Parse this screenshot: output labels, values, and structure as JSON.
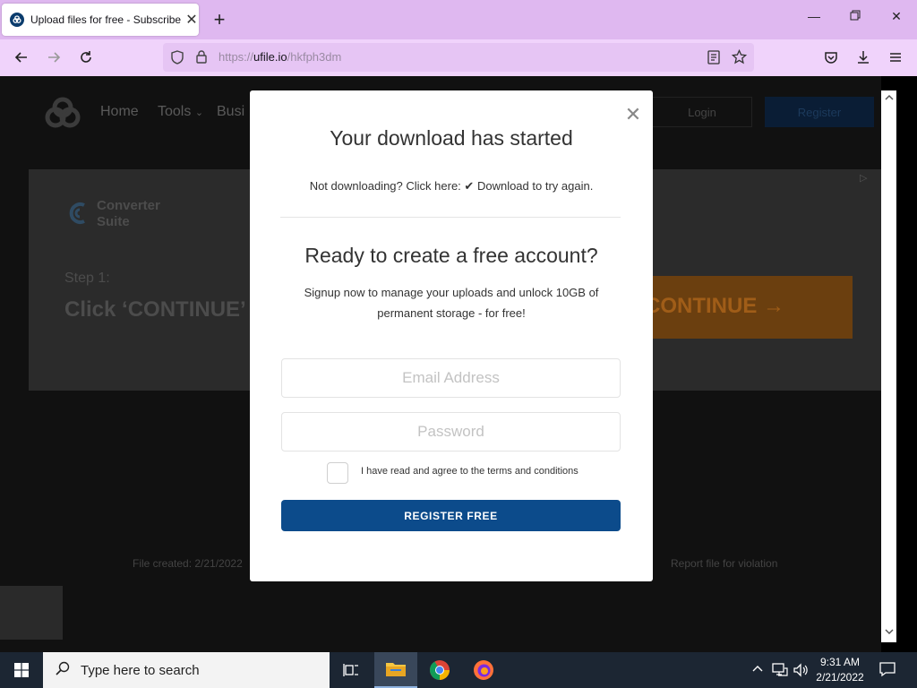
{
  "browser": {
    "tab_title": "Upload files for free - Subscribe",
    "url_prefix": "https://",
    "url_host": "ufile.io",
    "url_path": "/hkfph3dm"
  },
  "site": {
    "nav": [
      "Home",
      "Tools",
      "Busi"
    ],
    "login": "Login",
    "register": "Register",
    "file_created": "File created: 2/21/2022",
    "report": "Report file for violation"
  },
  "ad": {
    "brand": "Converter Suite",
    "step": "Step 1:",
    "click": "Click ‘CONTINUE’",
    "cta": "CONTINUE  →"
  },
  "modal": {
    "title": "Your download has started",
    "note_prefix": "Not downloading? Click here:",
    "note_link": "Download to try again.",
    "title2": "Ready to create a free account?",
    "subtitle": "Signup now to manage your uploads and unlock 10GB of permanent storage - for free!",
    "email_placeholder": "Email Address",
    "password_placeholder": "Password",
    "terms": "I have read and agree to the terms and conditions",
    "register_button": "REGISTER FREE",
    "accent": "#0c4b8b"
  },
  "taskbar": {
    "search_placeholder": "Type here to search",
    "time": "9:31 AM",
    "date": "2/21/2022"
  }
}
